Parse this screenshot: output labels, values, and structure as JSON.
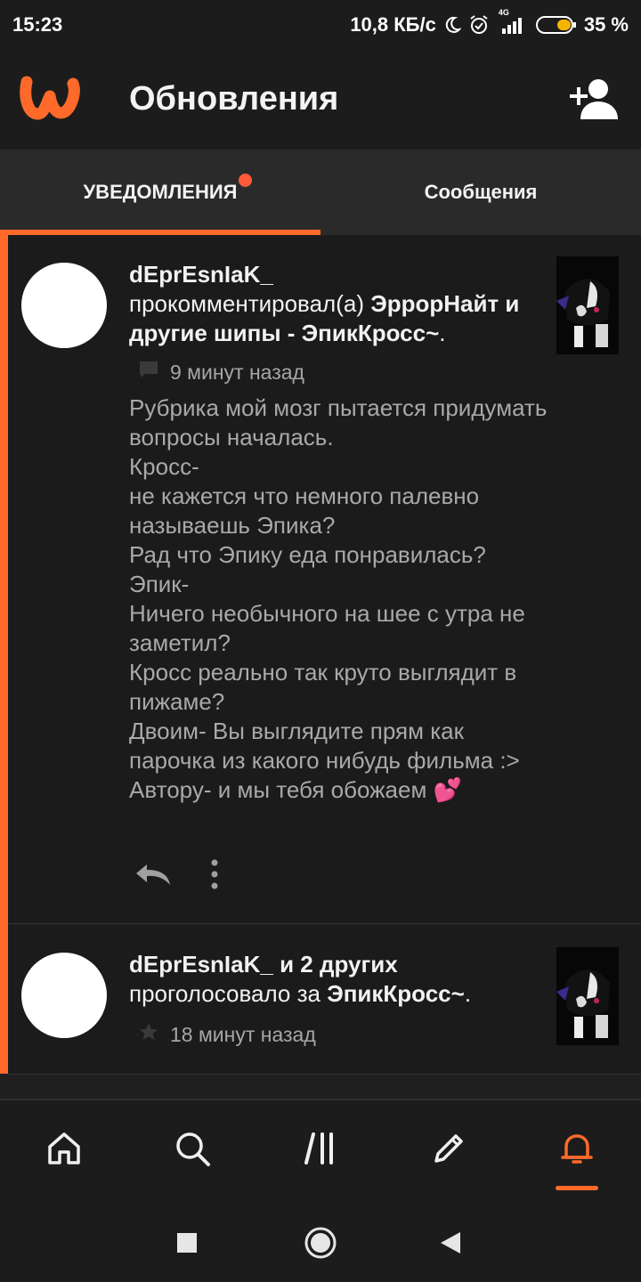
{
  "status_bar": {
    "time": "15:23",
    "network_speed": "10,8 КБ/с",
    "network_type": "4G",
    "battery_percent": "35 %",
    "battery_level": 0.35
  },
  "app_bar": {
    "title": "Обновления",
    "logo_icon": "wattpad-logo",
    "add_user_icon": "add-user-icon"
  },
  "tabs": [
    {
      "label": "УВЕДОМЛЕНИЯ",
      "active": true,
      "has_dot": true
    },
    {
      "label": "Сообщения",
      "active": false
    }
  ],
  "notifications": [
    {
      "user": "dEprEsnIaK_",
      "action": "прокомментировал(а)",
      "target": "ЭррорНайт и другие шипы - ЭпикКросс~",
      "target_suffix": ".",
      "time": "9 минут назад",
      "body": "Рубрика мой мозг пытается придумать вопросы началась.\nКросс-\nне кажется что немного палевно называешь Эпика?\nРад что Эпику еда понравилась?\nЭпик-\nНичего необычного на шее с утра не заметил?\nКросс реально так круто выглядит в пижаме?\nДвоим- Вы выглядите прям как парочка из какого нибудь фильма :>\nАвтору- и мы тебя обожаем",
      "emoji": "💕"
    },
    {
      "user": "dEprEsnIaK_",
      "user_suffix": "и 2 других",
      "action": "проголосовало за",
      "target": "ЭпикКросс~",
      "target_suffix": ".",
      "time": "18 минут назад"
    }
  ],
  "bottom_nav": [
    {
      "icon": "home-icon"
    },
    {
      "icon": "search-icon"
    },
    {
      "icon": "library-icon"
    },
    {
      "icon": "pencil-icon"
    },
    {
      "icon": "bell-icon",
      "active": true
    }
  ],
  "colors": {
    "accent": "#ff6a2b",
    "background": "#1b1b1b",
    "tab_bar": "#2a2a2a"
  }
}
